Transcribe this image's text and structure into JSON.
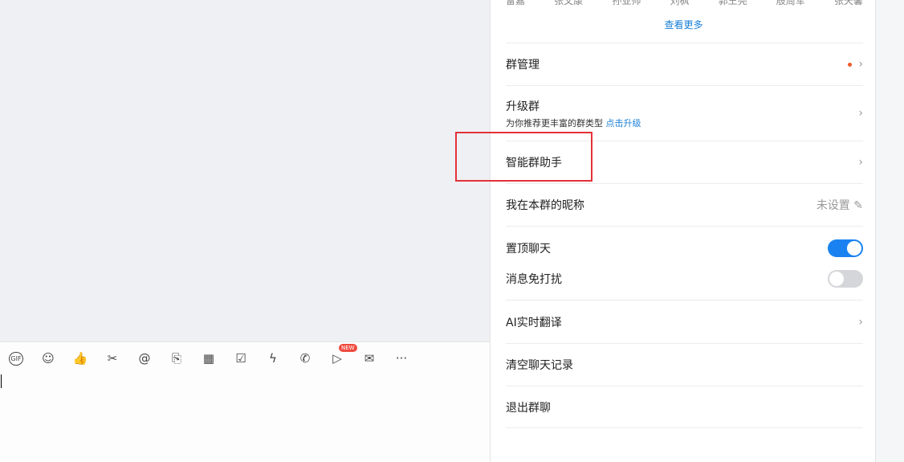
{
  "members": [
    "雷嘉",
    "张文康",
    "孙亚帅",
    "刘枫",
    "郭王亮",
    "殷周军",
    "张天馨"
  ],
  "view_more": "查看更多",
  "toolbar": {
    "items": [
      {
        "name": "gif-icon",
        "glyph": "GIF"
      },
      {
        "name": "emoji-icon",
        "glyph": "☺"
      },
      {
        "name": "thumbs-up-icon",
        "glyph": "👍"
      },
      {
        "name": "scissors-icon",
        "glyph": "✂"
      },
      {
        "name": "at-icon",
        "glyph": "@"
      },
      {
        "name": "file-add-icon",
        "glyph": "⎘"
      },
      {
        "name": "calendar-icon",
        "glyph": "▦"
      },
      {
        "name": "checkbox-icon",
        "glyph": "☑"
      },
      {
        "name": "lightning-icon",
        "glyph": "ϟ"
      },
      {
        "name": "video-call-icon",
        "glyph": "✆"
      },
      {
        "name": "live-icon",
        "glyph": "▷"
      },
      {
        "name": "mail-icon",
        "glyph": "✉"
      },
      {
        "name": "more-icon",
        "glyph": "···"
      }
    ],
    "new_badge": "NEW"
  },
  "settings": {
    "group_manage": "群管理",
    "upgrade": "升级群",
    "upgrade_sub": "为你推荐更丰富的群类型",
    "upgrade_link": "点击升级",
    "assistant": "智能群助手",
    "nickname": "我在本群的昵称",
    "nickname_value": "未设置",
    "pin": "置顶聊天",
    "pin_on": true,
    "mute": "消息免打扰",
    "mute_on": false,
    "translate": "AI实时翻译",
    "clear": "清空聊天记录",
    "exit": "退出群聊"
  },
  "colors": {
    "accent": "#1a82f0",
    "highlight": "#e3313a"
  }
}
